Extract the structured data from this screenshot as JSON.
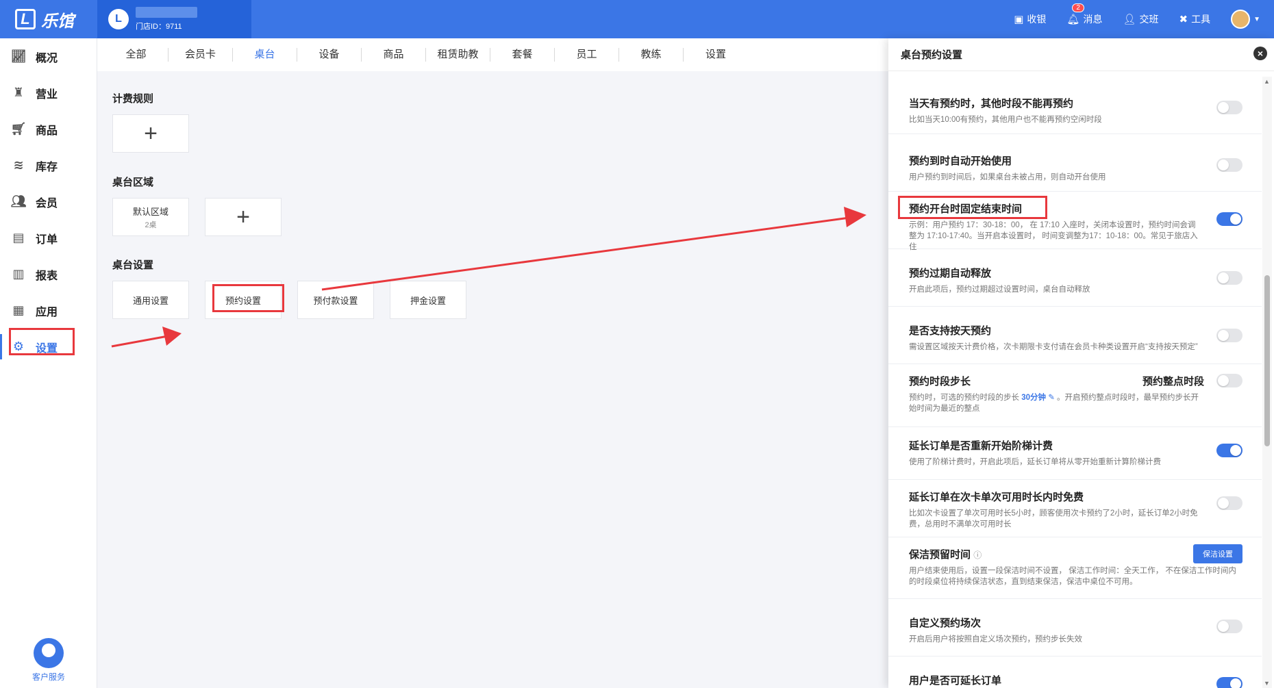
{
  "app": {
    "logo_mark": "L",
    "logo_text": "乐馆",
    "store_avatar": "L",
    "store_id": "门店ID：9711"
  },
  "topbar": {
    "actions": [
      {
        "icon": "cashier-icon",
        "label": "收银"
      },
      {
        "icon": "bell-icon",
        "label": "消息",
        "badge": "2"
      },
      {
        "icon": "handover-icon",
        "label": "交班"
      },
      {
        "icon": "tools-icon",
        "label": "工具"
      }
    ]
  },
  "sidebar": {
    "items": [
      {
        "icon": "chart-icon",
        "label": "概况"
      },
      {
        "icon": "bag-icon",
        "label": "营业"
      },
      {
        "icon": "cart-icon",
        "label": "商品"
      },
      {
        "icon": "layers-icon",
        "label": "库存"
      },
      {
        "icon": "user-icon",
        "label": "会员"
      },
      {
        "icon": "order-icon",
        "label": "订单"
      },
      {
        "icon": "bar-chart-icon",
        "label": "报表"
      },
      {
        "icon": "grid-icon",
        "label": "应用"
      },
      {
        "icon": "gear-icon",
        "label": "设置",
        "active": true
      }
    ],
    "service_label": "客户服务"
  },
  "tabs": [
    "全部",
    "会员卡",
    "桌台",
    "设备",
    "商品",
    "租赁助教",
    "套餐",
    "员工",
    "教练",
    "设置"
  ],
  "active_tab": "桌台",
  "main": {
    "billing_title": "计费规则",
    "area_title": "桌台区域",
    "default_area": {
      "name": "默认区域",
      "count": "2桌"
    },
    "settings_title": "桌台设置",
    "settings_cards": [
      "通用设置",
      "预约设置",
      "预付款设置",
      "押金设置"
    ]
  },
  "panel": {
    "title": "桌台预约设置",
    "settings": [
      {
        "title": "当天有预约时，其他时段不能再预约",
        "desc": "比如当天10:00有预约，其他用户也不能再预约空闲时段",
        "on": false
      },
      {
        "title": "预约到时自动开始使用",
        "desc": "用户预约到时间后，如果桌台未被占用，则自动开台使用",
        "on": false
      },
      {
        "title": "预约开台时固定结束时间",
        "desc": "示例：用户预约 17：30-18：00， 在 17:10 入座时，关闭本设置时，预约时间会调整为 17:10-17:40。当开启本设置时， 时间变调整为17：10-18：00。常见于旅店入住",
        "on": true
      },
      {
        "title": "预约过期自动释放",
        "desc": "开启此项后，预约过期超过设置时间，桌台自动释放",
        "on": false
      },
      {
        "title": "是否支持按天预约",
        "desc": "需设置区域按天计费价格，次卡期限卡支付请在会员卡种类设置开启“支持按天预定”",
        "on": false
      },
      {
        "title": "预约时段步长",
        "side_label": "预约整点时段",
        "desc_pre": "预约时，可选的预约时段的步长",
        "desc_link": "30分钟",
        "desc_post": "。开启预约整点时段时，最早预约步长开始时间为最近的整点",
        "on": false
      },
      {
        "title": "延长订单是否重新开始阶梯计费",
        "desc": "使用了阶梯计费时，开启此项后，延长订单将从零开始重新计算阶梯计费",
        "on": true
      },
      {
        "title": "延长订单在次卡单次可用时长内时免费",
        "desc": "比如次卡设置了单次可用时长5小时，顾客使用次卡预约了2小时，延长订单2小时免费，总用时不满单次可用时长",
        "on": false
      },
      {
        "title": "保洁预留时间",
        "button": "保洁设置",
        "desc": "用户结束使用后，设置一段保洁时间不设置， 保洁工作时间：全天工作， 不在保洁工作时间内的时段桌位将持续保洁状态，直到结束保洁，保洁中桌位不可用。"
      },
      {
        "title": "自定义预约场次",
        "desc": "开启后用户将按照自定义场次预约，预约步长失效",
        "on": false
      },
      {
        "title": "用户是否可延长订单",
        "desc": "",
        "on": true
      }
    ]
  },
  "colors": {
    "primary": "#3b76e6",
    "highlight": "#e8383d"
  }
}
